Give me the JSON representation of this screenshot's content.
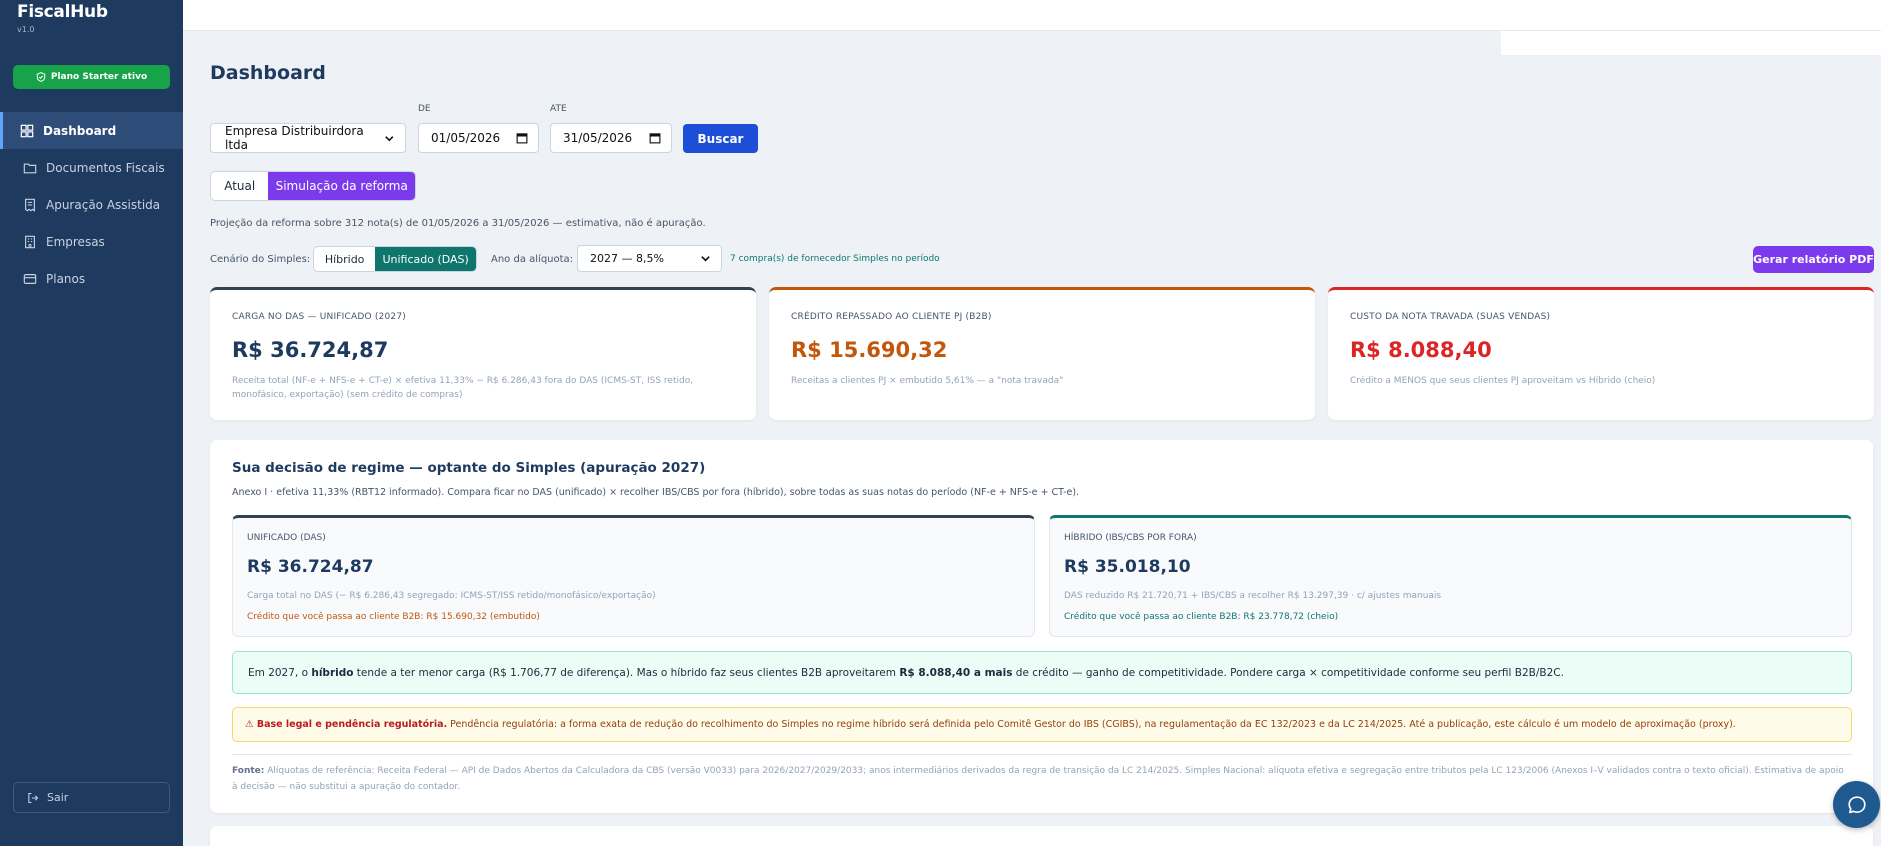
{
  "app": {
    "name": "FiscalHub",
    "version": "v1.0",
    "plan_badge": "Plano Starter ativo"
  },
  "nav": {
    "items": [
      {
        "label": "Dashboard",
        "icon": "dashboard-icon",
        "active": true
      },
      {
        "label": "Documentos Fiscais",
        "icon": "folder-icon"
      },
      {
        "label": "Apuração Assistida",
        "icon": "receipt-icon"
      },
      {
        "label": "Empresas",
        "icon": "building-icon"
      },
      {
        "label": "Planos",
        "icon": "credit-card-icon"
      }
    ],
    "logout": "Sair"
  },
  "page": {
    "title": "Dashboard"
  },
  "filters": {
    "company": "Empresa Distribuirdora ltda",
    "from_label": "DE",
    "from_value": "01/05/2026",
    "to_label": "ATE",
    "to_value": "31/05/2026",
    "search": "Buscar"
  },
  "view_toggle": {
    "current": "Atual",
    "simulation": "Simulação da reforma",
    "selected": "Simulação da reforma"
  },
  "projection": "Projeção da reforma sobre 312 nota(s) de 01/05/2026 a 31/05/2026 — estimativa, não é apuração.",
  "scenario": {
    "label": "Cenário do Simples:",
    "options": [
      "Híbrido",
      "Unificado (DAS)"
    ],
    "selected": "Unificado (DAS)",
    "rate_label": "Ano da alíquota:",
    "rate_value": "2027 — 8,5%",
    "supplier_note": "7 compra(s) de fornecedor Simples no período",
    "pdf_button": "Gerar relatório PDF"
  },
  "kpis": [
    {
      "label": "CARGA NO DAS — UNIFICADO (2027)",
      "value": "R$ 36.724,87",
      "sub": "Receita total (NF-e + NFS-e + CT-e) × efetiva 11,33% − R$ 6.286,43 fora do DAS (ICMS-ST, ISS retido, monofásico, exportação) (sem crédito de compras)",
      "color": "#1e3a5f"
    },
    {
      "label": "CRÉDITO REPASSADO AO CLIENTE PJ (B2B)",
      "value": "R$ 15.690,32",
      "sub": "Receitas a clientes PJ × embutido 5,61% — a \"nota travada\"",
      "color": "#c2570c"
    },
    {
      "label": "CUSTO DA NOTA TRAVADA (SUAS VENDAS)",
      "value": "R$ 8.088,40",
      "sub": "Crédito a MENOS que seus clientes PJ aproveitam vs Híbrido (cheio)",
      "color": "#dc2626"
    }
  ],
  "decision": {
    "title": "Sua decisão de regime — optante do Simples (apuração 2027)",
    "subtitle": "Anexo I · efetiva 11,33% (RBT12 informado). Compara ficar no DAS (unificado) × recolher IBS/CBS por fora (híbrido), sobre todas as suas notas do período (NF-e + NFS-e + CT-e).",
    "unified": {
      "label": "UNIFICADO (DAS)",
      "value": "R$ 36.724,87",
      "sub": "Carga total no DAS (− R$ 6.286,43 segregado: ICMS-ST/ISS retido/monofásico/exportação)",
      "note": "Crédito que você passa ao cliente B2B: R$ 15.690,32 (embutido)"
    },
    "hybrid": {
      "label": "HÍBRIDO (IBS/CBS POR FORA)",
      "value": "R$ 35.018,10",
      "sub": "DAS reduzido R$ 21.720,71 + IBS/CBS a recolher R$ 13.297,39 · c/ ajustes manuais",
      "note": "Crédito que você passa ao cliente B2B: R$ 23.778,72 (cheio)"
    },
    "insight": {
      "p1": "Em 2027, o ",
      "b1": "híbrido",
      "p2": " tende a ter menor carga (R$ 1.706,77 de diferença). Mas o híbrido faz seus clientes B2B aproveitarem ",
      "b2": "R$ 8.088,40 a mais",
      "p3": " de crédito — ganho de competitividade. Pondere carga × competitividade conforme seu perfil B2B/B2C."
    },
    "warning": {
      "title": "⚠ Base legal e pendência regulatória.",
      "text": " Pendência regulatória: a forma exata de redução do recolhimento do Simples no regime híbrido será definida pelo Comitê Gestor do IBS (CGIBS), na regulamentação da EC 132/2023 e da LC 214/2025. Até a publicação, este cálculo é um modelo de aproximação (proxy)."
    },
    "source": {
      "label": "Fonte:",
      "text": " Alíquotas de referência: Receita Federal — API de Dados Abertos da Calculadora da CBS (versão V0033) para 2026/2027/2029/2033; anos intermediários derivados da regra de transição da LC 214/2025. Simples Nacional: alíquota efetiva e segregação entre tributos pela LC 123/2006 (Anexos I–V validados contra o texto oficial). Estimativa de apoio à decisão — não substitui a apuração do contador."
    }
  },
  "colors": {
    "sidebar": "#1e3a5f",
    "primary": "#1d4ed8",
    "purple": "#7c3aed",
    "teal": "#0f766e",
    "orange": "#c2570c",
    "red": "#dc2626",
    "green": "#16a34a"
  }
}
